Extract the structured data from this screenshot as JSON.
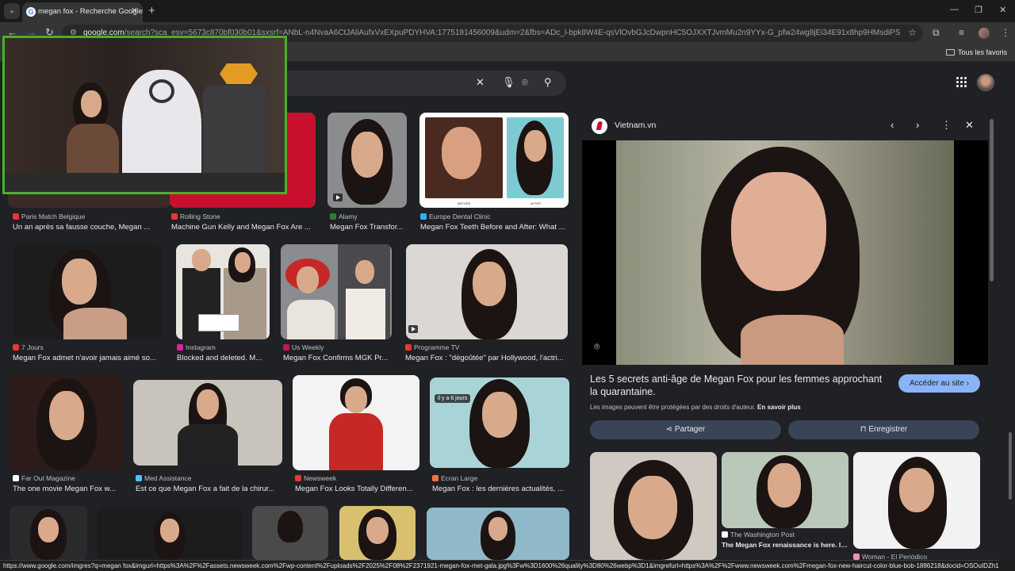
{
  "browser": {
    "tab_title": "megan fox - Recherche Google",
    "tab_favicon": "G",
    "url_host": "google.com",
    "url_rest": "/search?sca_esv=5673c870bf030b01&sxsrf=ANbL-n4NvaA6CtJAliAufxVxEXpuPDYHVA:1775181456009&udm=2&fbs=ADc_l-bpk8W4E-qsVlOvbGJcDwpnHC5OJXXTJvmMu2n9YYx-G_pfw24wg8jEi34E91x8hp9HMsdiPSn3Aed4tqflvNqWRG3...",
    "bookmarks_all": "Tous les favoris"
  },
  "results": [
    {
      "source": "Paris Match Belgique",
      "source_color": "#e53935",
      "caption": "Un an après sa fausse couche, Megan ..."
    },
    {
      "source": "Rolling Stone",
      "source_color": "#e53935",
      "caption": "Machine Gun Kelly and Megan Fox Are ..."
    },
    {
      "source": "Alamy",
      "source_color": "#2e7d32",
      "caption": "Megan Fox Transfor..."
    },
    {
      "source": "Europe Dental Clinic",
      "source_color": "#29b6f6",
      "caption": "Megan Fox Teeth Before and After: What ...",
      "before_label": "BEFORE",
      "after_label": "AFTER"
    },
    {
      "source": "7 Jours",
      "source_color": "#e53935",
      "caption": "Megan Fox admet n'avoir jamais aimé so..."
    },
    {
      "source": "Instagram",
      "source_color": "#d6249f",
      "caption": "Blocked and deleted. M..."
    },
    {
      "source": "Us Weekly",
      "source_color": "#c2185b",
      "caption": "Megan Fox Confirms MGK Pr..."
    },
    {
      "source": "Programme TV",
      "source_color": "#e53935",
      "caption": "Megan Fox : \"dégoûtée\" par Hollywood, l'actri..."
    },
    {
      "source": "Far Out Magazine",
      "source_color": "#ffffff",
      "caption": "The one movie Megan Fox w..."
    },
    {
      "source": "Med Assistance",
      "source_color": "#4fc3f7",
      "caption": "Est ce que Megan Fox a fait de la chirur..."
    },
    {
      "source": "Newsweek",
      "source_color": "#e53935",
      "caption": "Megan Fox Looks Totally Differen..."
    },
    {
      "source": "Ecran Large",
      "source_color": "#ff7043",
      "caption": "Megan Fox : les dernières actualités, ...",
      "badge": "il y a 6 jours"
    }
  ],
  "panel": {
    "site": "Vietnam.vn",
    "title": "Les 5 secrets anti-âge de Megan Fox pour les femmes approchant la quarantaine.",
    "visit_label": "Accéder au site",
    "copyright": "Les images peuvent être protégées par des droits d'auteur.",
    "learn_more": "En savoir plus",
    "share_label": "Partager",
    "save_label": "Enregistrer",
    "related": [
      {
        "source": "The Washington Post",
        "caption": "The Megan Fox renaissance is here. It's..."
      },
      {
        "source": "Woman - El Periódico",
        "caption": ""
      }
    ]
  },
  "status_url": "https://www.google.com/imgres?q=megan fox&imgurl=https%3A%2F%2Fassets.newsweek.com%2Fwp-content%2Fuploads%2F2025%2F08%2F2371921-megan-fox-met-gala.jpg%3Fw%3D1600%26quality%3D80%26webp%3D1&imgrefurl=https%3A%2F%2Fwww.newsweek.com%2Fmegan-fox-new-haircut-color-blue-bob-1886218&docid=OSOuIDZh1...",
  "colors": {
    "accent": "#8ab4f8",
    "cam_border": "#4caf2c",
    "page_bg": "#202124"
  }
}
